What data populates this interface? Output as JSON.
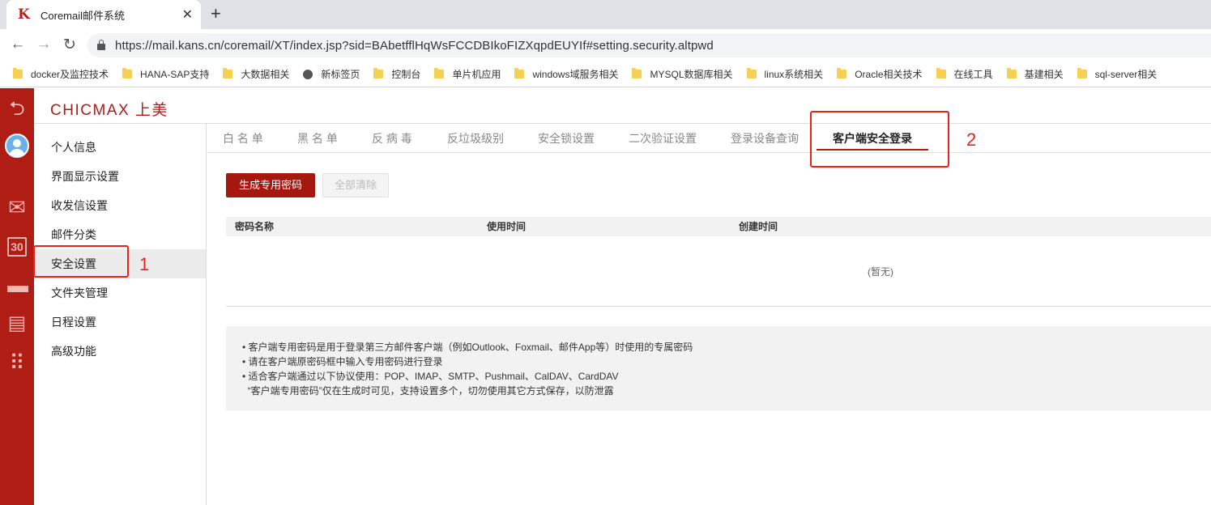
{
  "browser": {
    "tab_title": "Coremail邮件系统",
    "tab_favicon": "K",
    "close_glyph": "✕",
    "newtab_glyph": "+",
    "back_glyph": "←",
    "forward_glyph": "→",
    "reload_glyph": "↻",
    "url": "https://mail.kans.cn/coremail/XT/index.jsp?sid=BAbetfflHqWsFCCDBIkoFIZXqpdEUYIf#setting.security.altpwd",
    "bookmarks": [
      {
        "label": "docker及监控技术",
        "icon": "folder-icon"
      },
      {
        "label": "HANA-SAP支持",
        "icon": "folder-icon"
      },
      {
        "label": "大数据相关",
        "icon": "folder-icon"
      },
      {
        "label": "新标签页",
        "icon": "globe-icon"
      },
      {
        "label": "控制台",
        "icon": "folder-icon"
      },
      {
        "label": "单片机应用",
        "icon": "folder-icon"
      },
      {
        "label": "windows域服务相关",
        "icon": "folder-icon"
      },
      {
        "label": "MYSQL数据库相关",
        "icon": "folder-icon"
      },
      {
        "label": "linux系统相关",
        "icon": "folder-icon"
      },
      {
        "label": "Oracle相关技术",
        "icon": "folder-icon"
      },
      {
        "label": "在线工具",
        "icon": "folder-icon"
      },
      {
        "label": "基建相关",
        "icon": "folder-icon"
      },
      {
        "label": "sql-server相关",
        "icon": "folder-icon"
      }
    ]
  },
  "app": {
    "logo": "CHICMAX 上美",
    "leftbar_icons": {
      "back": "⮌",
      "mail": "✉",
      "calendar": "30",
      "folder": "▬",
      "contacts": "▤",
      "apps": "⠿"
    },
    "sidebar": [
      {
        "label": "个人信息",
        "active": false
      },
      {
        "label": "界面显示设置",
        "active": false
      },
      {
        "label": "收发信设置",
        "active": false
      },
      {
        "label": "邮件分类",
        "active": false
      },
      {
        "label": "安全设置",
        "active": true
      },
      {
        "label": "文件夹管理",
        "active": false
      },
      {
        "label": "日程设置",
        "active": false
      },
      {
        "label": "高级功能",
        "active": false
      }
    ],
    "tabs": [
      {
        "label": "白 名 单",
        "active": false
      },
      {
        "label": "黑 名 单",
        "active": false
      },
      {
        "label": "反 病 毒",
        "active": false
      },
      {
        "label": "反垃圾级别",
        "active": false
      },
      {
        "label": "安全锁设置",
        "active": false
      },
      {
        "label": "二次验证设置",
        "active": false
      },
      {
        "label": "登录设备查询",
        "active": false
      },
      {
        "label": "客户端安全登录",
        "active": true
      }
    ],
    "buttons": {
      "generate": "生成专用密码",
      "clear_all": "全部清除"
    },
    "table": {
      "columns": [
        "密码名称",
        "使用时间",
        "创建时间"
      ],
      "empty_text": "(暂无)"
    },
    "notes": [
      "• 客户端专用密码是用于登录第三方邮件客户端（例如Outlook、Foxmail、邮件App等）时使用的专属密码",
      "• 请在客户端原密码框中输入专用密码进行登录",
      "• 适合客户端通过以下协议使用：POP、IMAP、SMTP、Pushmail、CalDAV、CardDAV",
      "  “客户端专用密码”仅在生成时可见，支持设置多个，切勿使用其它方式保存，以防泄露"
    ],
    "accent_color": "#b01d15"
  },
  "annotations": {
    "label_1": "1",
    "label_2": "2",
    "color": "#e8231b"
  }
}
